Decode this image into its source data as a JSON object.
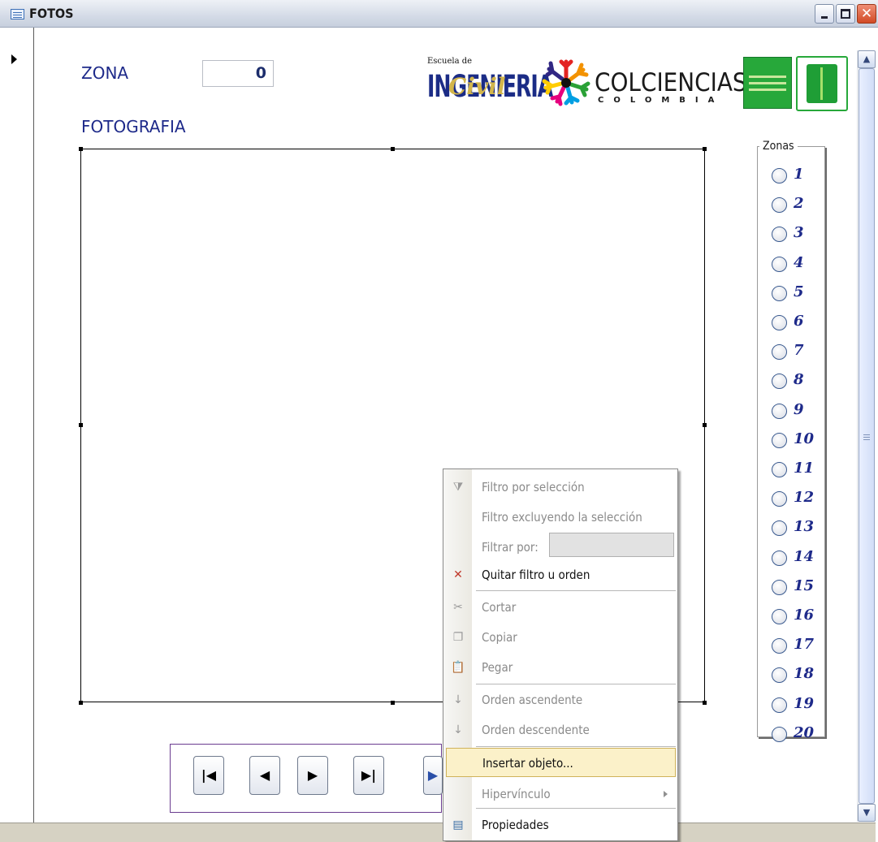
{
  "window": {
    "title": "FOTOS"
  },
  "form": {
    "zona_label": "ZONA",
    "zona_value": "0",
    "foto_label": "FOTOGRAFIA"
  },
  "logos": {
    "ingenieria_small": "Escuela de",
    "ingenieria_big": "INGENIERIA",
    "ingenieria_script": "Civil",
    "colciencias": "COLCIENCIAS",
    "colciencias_sub": "COLOMBIA"
  },
  "zonas": {
    "title": "Zonas",
    "items": [
      "1",
      "2",
      "3",
      "4",
      "5",
      "6",
      "7",
      "8",
      "9",
      "10",
      "11",
      "12",
      "13",
      "14",
      "15",
      "16",
      "17",
      "18",
      "19",
      "20"
    ]
  },
  "context_menu": {
    "items": [
      {
        "label": "Filtro por selección",
        "disabled": true,
        "icon": "filter-selection-icon"
      },
      {
        "label": "Filtro excluyendo la selección",
        "disabled": true,
        "icon": ""
      },
      {
        "label": "Filtrar por:",
        "disabled": true,
        "icon": ""
      },
      {
        "label": "Quitar filtro u orden",
        "disabled": false,
        "icon": "remove-filter-icon"
      },
      {
        "label": "Cortar",
        "disabled": true,
        "icon": "cut-icon"
      },
      {
        "label": "Copiar",
        "disabled": true,
        "icon": "copy-icon"
      },
      {
        "label": "Pegar",
        "disabled": true,
        "icon": "paste-icon"
      },
      {
        "label": "Orden ascendente",
        "disabled": true,
        "icon": "sort-ascending-icon"
      },
      {
        "label": "Orden descendente",
        "disabled": true,
        "icon": "sort-descending-icon"
      },
      {
        "label": "Insertar objeto...",
        "disabled": false,
        "icon": ""
      },
      {
        "label": "Hipervínculo",
        "disabled": true,
        "icon": ""
      },
      {
        "label": "Propiedades",
        "disabled": false,
        "icon": "properties-icon"
      }
    ]
  },
  "colors": {
    "label_blue": "#1e2a8a",
    "highlight": "#fbf1c9",
    "nav_border": "#6a3c8f"
  }
}
